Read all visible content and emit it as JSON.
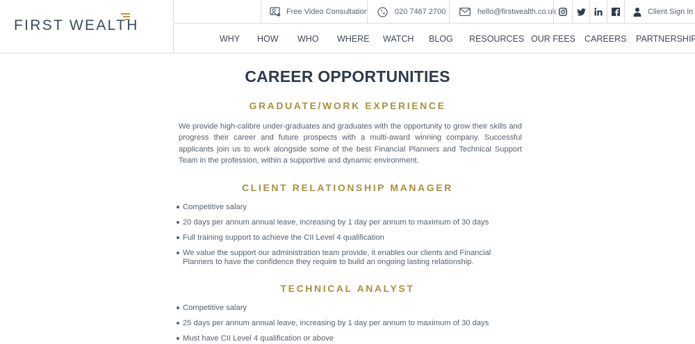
{
  "header": {
    "logo_text": "FIRST WEALTH",
    "topbar": {
      "video_label": "Free Video Consultation",
      "phone_label": "020 7467 2700",
      "email_label": "hello@firstwealth.co.uk",
      "social": [
        "instagram-icon",
        "twitter-icon",
        "linkedin-icon",
        "facebook-icon"
      ],
      "client_label": "Client Sign In"
    },
    "nav": [
      "WHY",
      "HOW",
      "WHO",
      "WHERE",
      "WATCH",
      "BLOG",
      "RESOURCES",
      "OUR FEES",
      "CAREERS",
      "PARTNERSHIPS"
    ]
  },
  "colors": {
    "accent": "#a8913b",
    "text": "#55606b",
    "heading": "#2e3b4c",
    "logo_mark": "#b59a3c"
  },
  "main": {
    "page_title": "CAREER OPPORTUNITIES",
    "sections": [
      {
        "title": "GRADUATE/WORK EXPERIENCE",
        "text": "We provide high-calibre under-graduates and graduates with the opportunity to grow their skills and progress their career and future prospects with a multi-award winning company.  Successful applicants join us to work alongside some of the best Financial Planners and Technical Support Team in the profession, within a supportive and dynamic environment."
      },
      {
        "title": "CLIENT RELATIONSHIP MANAGER",
        "bullets": [
          "Competitive salary",
          "20 days per annum annual leave, increasing by 1 day per annum to maximum of 30 days",
          "Full training support to achieve the CII Level 4 qualification",
          "We value the support our administration team provide, it enables our clients and Financial Planners to have the confidence they require to build an ongoing lasting relationship."
        ]
      },
      {
        "title": "TECHNICAL ANALYST",
        "bullets": [
          "Competitive salary",
          "25 days per annum annual leave, increasing by 1 day per annum to maximum of 30 days",
          "Must have CII Level 4 qualification or above"
        ]
      }
    ]
  }
}
